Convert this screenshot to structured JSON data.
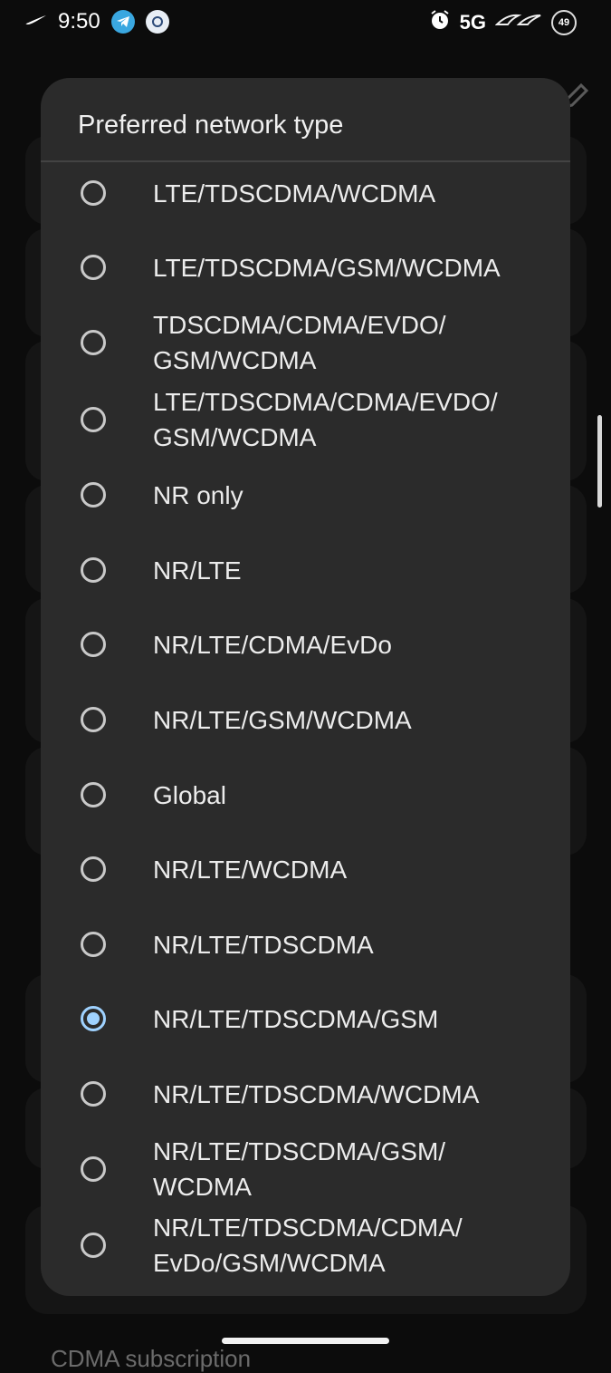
{
  "status_bar": {
    "time": "9:50",
    "network": "5G",
    "battery": "49",
    "icons": [
      "nike-swoosh-icon",
      "telegram-icon",
      "app-notification-icon",
      "alarm-icon",
      "rog-logo-icon",
      "battery-icon"
    ]
  },
  "background": {
    "visible_text": "CDMA subscription"
  },
  "dialog": {
    "title": "Preferred network type",
    "selected": "NR/LTE/TDSCDMA/GSM",
    "accent_color": "#9fd2ff",
    "options": [
      {
        "line1": "LTE/TDSCDMA/WCDMA",
        "line2": ""
      },
      {
        "line1": "LTE/TDSCDMA/GSM/WCDMA",
        "line2": ""
      },
      {
        "line1": "TDSCDMA/CDMA/EVDO/",
        "line2": "GSM/WCDMA"
      },
      {
        "line1": "LTE/TDSCDMA/CDMA/EVDO/",
        "line2": "GSM/WCDMA"
      },
      {
        "line1": "NR only",
        "line2": ""
      },
      {
        "line1": "NR/LTE",
        "line2": ""
      },
      {
        "line1": "NR/LTE/CDMA/EvDo",
        "line2": ""
      },
      {
        "line1": "NR/LTE/GSM/WCDMA",
        "line2": ""
      },
      {
        "line1": "Global",
        "line2": ""
      },
      {
        "line1": "NR/LTE/WCDMA",
        "line2": ""
      },
      {
        "line1": "NR/LTE/TDSCDMA",
        "line2": ""
      },
      {
        "line1": "NR/LTE/TDSCDMA/GSM",
        "line2": ""
      },
      {
        "line1": "NR/LTE/TDSCDMA/WCDMA",
        "line2": ""
      },
      {
        "line1": "NR/LTE/TDSCDMA/GSM/",
        "line2": "WCDMA"
      },
      {
        "line1": "NR/LTE/TDSCDMA/CDMA/",
        "line2": "EvDo/GSM/WCDMA"
      }
    ]
  }
}
